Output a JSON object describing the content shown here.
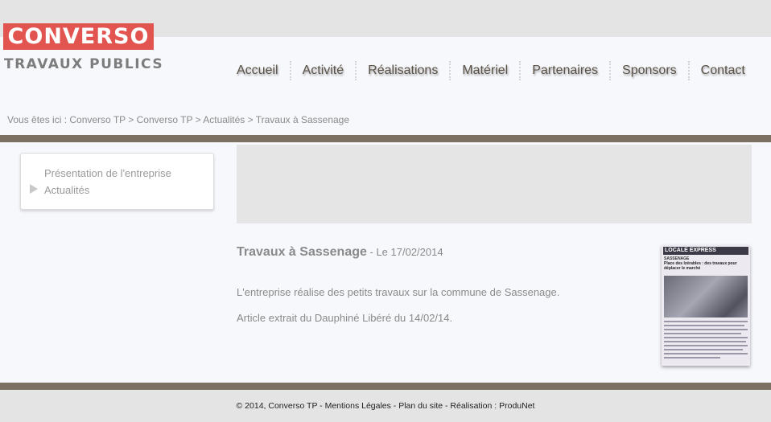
{
  "logo": {
    "brand": "CONVERSO",
    "tagline": "TRAVAUX PUBLICS"
  },
  "nav": {
    "items": [
      "Accueil",
      "Activité",
      "Réalisations",
      "Matériel",
      "Partenaires",
      "Sponsors",
      "Contact"
    ]
  },
  "breadcrumb": "Vous êtes ici : Converso TP > Converso TP > Actualités > Travaux à Sassenage",
  "sidebar": {
    "items": [
      "Présentation de l'entreprise",
      "Actualités"
    ]
  },
  "article": {
    "title": "Travaux à Sassenage",
    "date": " - Le 17/02/2014",
    "paragraphs": [
      "L'entreprise réalise des petits travaux sur la commune de Sassenage.",
      "Article extrait du Dauphiné Libéré du 14/02/14."
    ],
    "clipping": {
      "header": "LOCALE EXPRESS",
      "section": "SASSENAGE",
      "headline": "Place des Izérables : des travaux pour déplacer le marché"
    }
  },
  "footer": "© 2014, Converso TP - Mentions Légales - Plan du site - Réalisation : ProduNet",
  "colors": {
    "brand_red": "#e25450",
    "band_brown": "#7c7062"
  }
}
